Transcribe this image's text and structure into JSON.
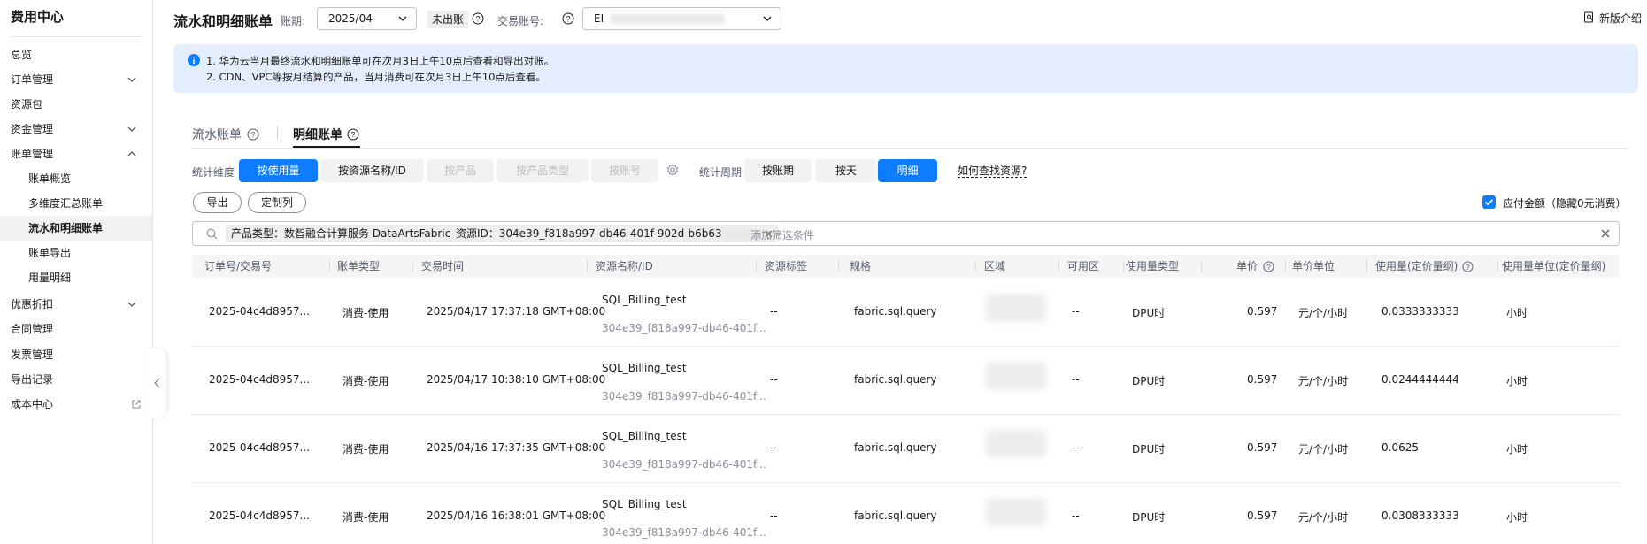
{
  "sidebar": {
    "title": "费用中心",
    "items": [
      {
        "label": "总览"
      },
      {
        "label": "订单管理"
      },
      {
        "label": "资源包"
      },
      {
        "label": "资金管理"
      },
      {
        "label": "账单管理"
      },
      {
        "label": "账单概览"
      },
      {
        "label": "多维度汇总账单"
      },
      {
        "label": "流水和明细账单"
      },
      {
        "label": "账单导出"
      },
      {
        "label": "用量明细"
      },
      {
        "label": "优惠折扣"
      },
      {
        "label": "合同管理"
      },
      {
        "label": "发票管理"
      },
      {
        "label": "导出记录"
      },
      {
        "label": "成本中心"
      }
    ]
  },
  "header": {
    "title": "流水和明细账单",
    "period_label": "账期:",
    "period_value": "2025/04",
    "status_tag": "未出账",
    "account_label": "交易账号:",
    "account_value": "EI",
    "new_intro": "新版介绍"
  },
  "notice": {
    "line1": "1. 华为云当月最终流水和明细账单可在次月3日上午10点后查看和导出对账。",
    "line2": "2. CDN、VPC等按月结算的产品，当月消费可在次月3日上午10点后查看。"
  },
  "tabs": [
    {
      "label": "流水账单"
    },
    {
      "label": "明细账单"
    }
  ],
  "filters": {
    "dimension_label": "统计维度",
    "dimension_options": [
      "按使用量",
      "按资源名称/ID",
      "按产品",
      "按产品类型",
      "按账号"
    ],
    "period_label": "统计周期",
    "period_options": [
      "按账期",
      "按天",
      "明细"
    ],
    "help_link": "如何查找资源?"
  },
  "actions": {
    "export": "导出",
    "customize": "定制列",
    "payable_label": "应付金额（隐藏0元消费）"
  },
  "search": {
    "chips": [
      {
        "label": "产品类型：数智融合计算服务 DataArtsFabric"
      },
      {
        "label": "资源ID：304e39_f818a997-db46-401f-902d-b6b63"
      }
    ],
    "placeholder": "添加筛选条件"
  },
  "table": {
    "columns": [
      "订单号/交易号",
      "账单类型",
      "交易时间",
      "资源名称/ID",
      "资源标签",
      "规格",
      "区域",
      "可用区",
      "使用量类型",
      "单价",
      "单价单位",
      "使用量(定价量纲)",
      "使用量单位(定价量纲)"
    ],
    "rows": [
      {
        "order": "2025-04c4d8957...",
        "type": "消费-使用",
        "time": "2025/04/17 17:37:18 GMT+08:00",
        "res_name": "SQL_Billing_test",
        "res_id": "304e39_f818a997-db46-401f...",
        "tag": "--",
        "spec": "fabric.sql.query",
        "zone": "--",
        "usage_type": "DPU时",
        "price": "0.597",
        "price_unit": "元/个/小时",
        "usage": "0.0333333333",
        "usage_unit": "小时"
      },
      {
        "order": "2025-04c4d8957...",
        "type": "消费-使用",
        "time": "2025/04/17 10:38:10 GMT+08:00",
        "res_name": "SQL_Billing_test",
        "res_id": "304e39_f818a997-db46-401f...",
        "tag": "--",
        "spec": "fabric.sql.query",
        "zone": "--",
        "usage_type": "DPU时",
        "price": "0.597",
        "price_unit": "元/个/小时",
        "usage": "0.0244444444",
        "usage_unit": "小时"
      },
      {
        "order": "2025-04c4d8957...",
        "type": "消费-使用",
        "time": "2025/04/16 17:37:35 GMT+08:00",
        "res_name": "SQL_Billing_test",
        "res_id": "304e39_f818a997-db46-401f...",
        "tag": "--",
        "spec": "fabric.sql.query",
        "zone": "--",
        "usage_type": "DPU时",
        "price": "0.597",
        "price_unit": "元/个/小时",
        "usage": "0.0625",
        "usage_unit": "小时"
      },
      {
        "order": "2025-04c4d8957...",
        "type": "消费-使用",
        "time": "2025/04/16 16:38:01 GMT+08:00",
        "res_name": "SQL_Billing_test",
        "res_id": "304e39_f818a997-db46-401f...",
        "tag": "--",
        "spec": "fabric.sql.query",
        "zone": "--",
        "usage_type": "DPU时",
        "price": "0.597",
        "price_unit": "元/个/小时",
        "usage": "0.0308333333",
        "usage_unit": "小时"
      }
    ]
  },
  "colors": {
    "accent": "#0d7cff",
    "notice_bg": "#e3edfb",
    "sidebar_active_bg": "#f2f2f2"
  }
}
